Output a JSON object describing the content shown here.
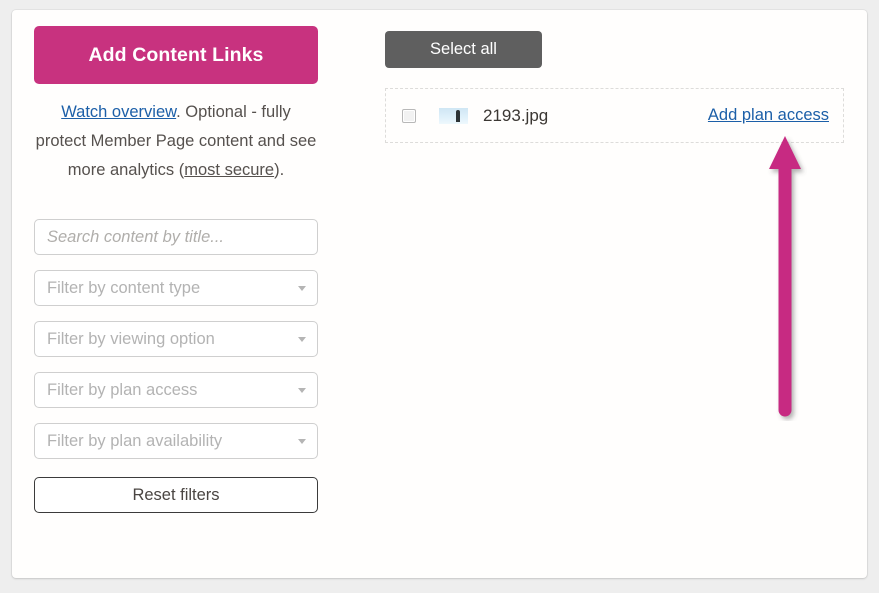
{
  "page": {
    "background_color": "#eeeeee",
    "card_color": "#fffefd"
  },
  "left_panel": {
    "primary_button": {
      "label": "Add Content Links",
      "color": "#c8327f",
      "text_color": "#ffffff"
    },
    "help_text": {
      "link_label": "Watch overview",
      "link_color": "#1c5fa8",
      "segment_1": ".  Optional - fully protect Member Page content and see more analytics (",
      "emphasis_label": "most secure",
      "segment_2": ")."
    },
    "filters": [
      {
        "name": "search",
        "placeholder": "Search content by title...",
        "type": "text",
        "italic": true
      },
      {
        "name": "content-type",
        "placeholder": "Filter by content type",
        "type": "select",
        "italic": false
      },
      {
        "name": "viewing-option",
        "placeholder": "Filter by viewing option",
        "type": "select",
        "italic": false
      },
      {
        "name": "plan-access",
        "placeholder": "Filter by plan access",
        "type": "select",
        "italic": false
      },
      {
        "name": "plan-availability",
        "placeholder": "Filter by plan availability",
        "type": "select",
        "italic": false
      }
    ],
    "reset_button": {
      "label": "Reset filters"
    }
  },
  "right_panel": {
    "select_all_button": {
      "label": "Select all",
      "color": "#5f5f5f"
    },
    "content_rows": [
      {
        "checked": false,
        "thumbnail": "image-thumbnail",
        "filename": "2193.jpg",
        "action_label": "Add plan access",
        "action_color": "#1c5fa8"
      }
    ]
  },
  "annotation": {
    "type": "arrow-up",
    "color": "#c72b82",
    "points_to": "Add plan access"
  }
}
